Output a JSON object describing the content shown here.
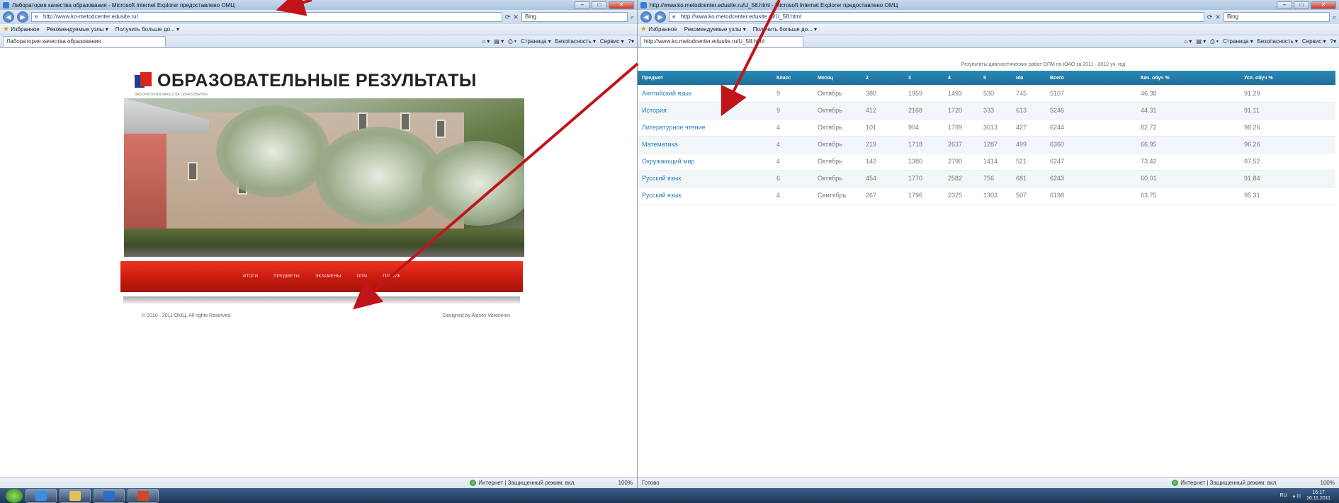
{
  "left_window": {
    "title": "Лаборатория качества образования - Microsoft Internet Explorer предоставлено ОМЦ",
    "url": "http://www.ko-metodcenter.edusite.ru/",
    "url_host": "edusite.ru",
    "search_engine": "Bing",
    "favorites_label": "Избранное",
    "fav_link_1": "Рекомендуемые узлы ▾",
    "fav_link_2": "Получить больше до... ▾",
    "tab_label": "Лаборатория качества образования",
    "cmd_page": "Страница ▾",
    "cmd_security": "Безопасность ▾",
    "cmd_service": "Сервис ▾",
    "status_zone": "Интернет | Защищенный режим: вкл.",
    "zoom": "100%",
    "site": {
      "title": "ОБРАЗОВАТЕЛЬНЫЕ РЕЗУЛЬТАТЫ",
      "subtitle": "ЛАБОРАТОРИЯ КАЧЕСТВА ОБРАЗОВАНИЯ",
      "nav": [
        "ИТОГИ",
        "ПРЕДМЕТЫ",
        "ЭКЗАМЕНЫ",
        "ОПМ",
        "ГРАФИК"
      ],
      "footer_left": "© 2010 - 2011 ОМЦ. All rights Reserved.",
      "footer_right": "Designed by Alexey Voronenin"
    }
  },
  "right_window": {
    "title": "http://www.ko.metodcenter.edusite.ru/U_58.html - Microsoft Internet Explorer предоставлено ОМЦ",
    "url": "http://www.ko.metodcenter.edusite.ru/U_58.html",
    "url_host": "edusite.ru",
    "search_engine": "Bing",
    "favorites_label": "Избранное",
    "fav_link_1": "Рекомендуемые узлы ▾",
    "fav_link_2": "Получить больше до... ▾",
    "tab_label": "http://www.ko.metodcenter.edusite.ru/U_58.html",
    "cmd_page": "Страница ▾",
    "cmd_security": "Безопасность ▾",
    "cmd_service": "Сервис ▾",
    "status_left": "Готово",
    "status_zone": "Интернет | Защищенный режим: вкл.",
    "zoom": "100%",
    "report_title": "Результаты диагностических работ ОПМ по ЮАО за 2011 - 2012 уч. год",
    "columns": [
      "Предмет",
      "Класс",
      "Месяц",
      "2",
      "3",
      "4",
      "5",
      "н/я",
      "Всего",
      "Кач. обуч %",
      "Усп. обуч %"
    ],
    "rows": [
      [
        "Английский язык",
        "9",
        "Октябрь",
        "380",
        "1959",
        "1493",
        "530",
        "745",
        "5107",
        "46.38",
        "91.29"
      ],
      [
        "История",
        "9",
        "Октябрь",
        "412",
        "2168",
        "1720",
        "333",
        "613",
        "5246",
        "44.31",
        "91.11"
      ],
      [
        "Литературное чтение",
        "4",
        "Октябрь",
        "101",
        "904",
        "1799",
        "3013",
        "427",
        "6244",
        "82.72",
        "98.26"
      ],
      [
        "Математика",
        "4",
        "Октябрь",
        "219",
        "1718",
        "2637",
        "1287",
        "499",
        "6360",
        "66.95",
        "96.26"
      ],
      [
        "Окружающий мир",
        "4",
        "Октябрь",
        "142",
        "1380",
        "2790",
        "1414",
        "521",
        "6247",
        "73.42",
        "97.52"
      ],
      [
        "Русский язык",
        "6",
        "Октябрь",
        "454",
        "1770",
        "2582",
        "756",
        "681",
        "6243",
        "60.01",
        "91.84"
      ],
      [
        "Русский язык",
        "4",
        "Сентябрь",
        "267",
        "1796",
        "2325",
        "1303",
        "507",
        "6198",
        "63.75",
        "95.31"
      ]
    ]
  },
  "taskbar": {
    "lang": "RU",
    "time": "16:17",
    "date": "16.11.2011"
  },
  "colors": {
    "annotation_arrow": "#c0141c",
    "table_header": "#1f76a0",
    "nav_band": "#d8220f"
  }
}
